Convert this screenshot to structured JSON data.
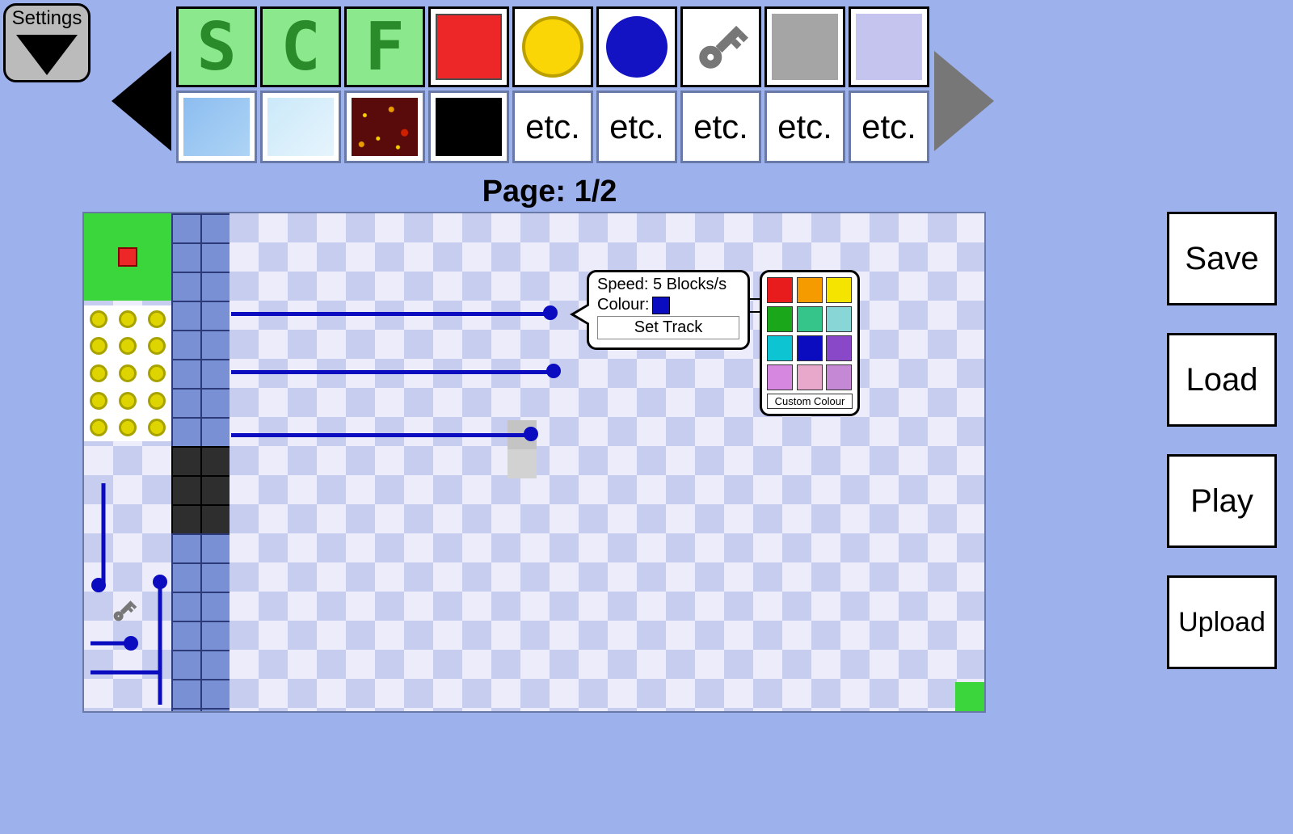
{
  "settings": {
    "label": "Settings"
  },
  "palette": {
    "row1": [
      {
        "kind": "letter",
        "text": "S"
      },
      {
        "kind": "letter",
        "text": "C"
      },
      {
        "kind": "letter",
        "text": "F"
      },
      {
        "kind": "red-square"
      },
      {
        "kind": "yellow-circle"
      },
      {
        "kind": "blue-circle"
      },
      {
        "kind": "key"
      },
      {
        "kind": "gray-square"
      },
      {
        "kind": "lavender-square"
      }
    ],
    "row2": [
      {
        "kind": "ice1"
      },
      {
        "kind": "ice2"
      },
      {
        "kind": "lava"
      },
      {
        "kind": "black"
      },
      {
        "kind": "etc",
        "text": "etc."
      },
      {
        "kind": "etc",
        "text": "etc."
      },
      {
        "kind": "etc",
        "text": "etc."
      },
      {
        "kind": "etc",
        "text": "etc."
      },
      {
        "kind": "etc",
        "text": "etc."
      }
    ],
    "page_label": "Page: 1/2",
    "page_current": 1,
    "page_total": 2
  },
  "side_buttons": {
    "save": "Save",
    "load": "Load",
    "play": "Play",
    "upload": "Upload"
  },
  "tooltip": {
    "speed_label": "Speed: 5 Blocks/s",
    "speed_value": 5,
    "colour_label": "Colour:",
    "colour_value": "#0b0bc0",
    "set_track": "Set Track"
  },
  "colour_picker": {
    "swatches": [
      "#e81c1c",
      "#f59b00",
      "#f5e400",
      "#1aa81a",
      "#35c48a",
      "#88d6d6",
      "#0cc4d2",
      "#0b0bc0",
      "#8848c8",
      "#d688e0",
      "#e8a8cc",
      "#c488d4"
    ],
    "custom_label": "Custom Colour"
  },
  "canvas": {
    "coins_cols": 3,
    "coins_rows": 5,
    "tracks": [
      {
        "label": "track-1"
      },
      {
        "label": "track-2"
      },
      {
        "label": "track-3"
      }
    ]
  }
}
